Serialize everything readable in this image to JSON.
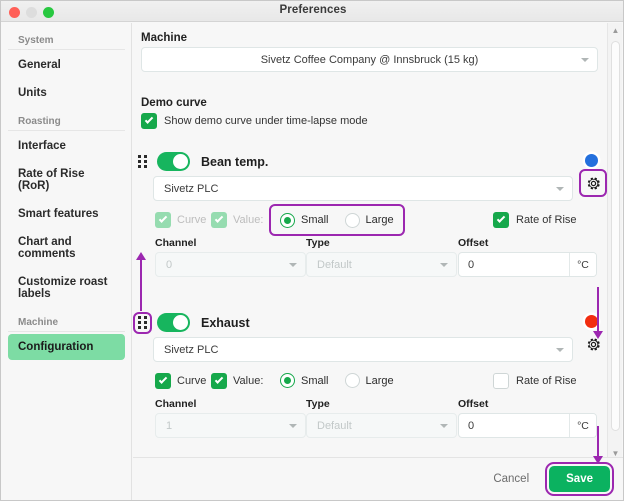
{
  "window": {
    "title": "Preferences",
    "traffic_lights": [
      "close-button",
      "minimize-button",
      "maximize-button"
    ]
  },
  "sidebar": {
    "groups": [
      {
        "label": "System",
        "items": [
          {
            "label": "General",
            "active": false
          },
          {
            "label": "Units",
            "active": false
          }
        ]
      },
      {
        "label": "Roasting",
        "items": [
          {
            "label": "Interface",
            "active": false
          },
          {
            "label": "Rate of Rise (RoR)",
            "active": false
          },
          {
            "label": "Smart features",
            "active": false
          },
          {
            "label": "Chart and comments",
            "active": false
          },
          {
            "label": "Customize roast labels",
            "active": false
          }
        ]
      },
      {
        "label": "Machine",
        "items": [
          {
            "label": "Configuration",
            "active": true
          }
        ]
      }
    ]
  },
  "main": {
    "machine": {
      "label": "Machine",
      "selected": "Sivetz Coffee Company  @ Innsbruck (15 kg)"
    },
    "demo_curve": {
      "label": "Demo curve",
      "checkbox_label": "Show demo curve under time-lapse mode",
      "checked": true
    },
    "devices": [
      {
        "name": "Bean temp.",
        "enabled": true,
        "source": "Sivetz PLC",
        "color_dot": "#2470dd",
        "curve": {
          "label": "Curve",
          "checked": true,
          "disabled": true
        },
        "value": {
          "label": "Value:",
          "checked": true,
          "disabled": true
        },
        "size": {
          "options": [
            "Small",
            "Large"
          ],
          "selected": "Small"
        },
        "rate_of_rise": {
          "label": "Rate of Rise",
          "checked": true
        },
        "channel": {
          "label": "Channel",
          "value": "0",
          "disabled": true
        },
        "type": {
          "label": "Type",
          "value": "Default",
          "disabled": true
        },
        "offset": {
          "label": "Offset",
          "value": "0",
          "unit": "°C"
        }
      },
      {
        "name": "Exhaust",
        "enabled": true,
        "source": "Sivetz PLC",
        "color_dot": "#f22d10",
        "curve": {
          "label": "Curve",
          "checked": true,
          "disabled": false
        },
        "value": {
          "label": "Value:",
          "checked": true,
          "disabled": false
        },
        "size": {
          "options": [
            "Small",
            "Large"
          ],
          "selected": "Small"
        },
        "rate_of_rise": {
          "label": "Rate of Rise",
          "checked": false
        },
        "channel": {
          "label": "Channel",
          "value": "1",
          "disabled": true
        },
        "type": {
          "label": "Type",
          "value": "Default",
          "disabled": true
        },
        "offset": {
          "label": "Offset",
          "value": "0",
          "unit": "°C"
        }
      }
    ]
  },
  "footer": {
    "cancel_label": "Cancel",
    "save_label": "Save"
  },
  "annotations": {
    "highlight_color": "#9c27b0",
    "highlights": [
      "bean-temp-size-radio-group",
      "bean-temp-settings-gear",
      "exhaust-drag-handle",
      "save-button"
    ]
  }
}
